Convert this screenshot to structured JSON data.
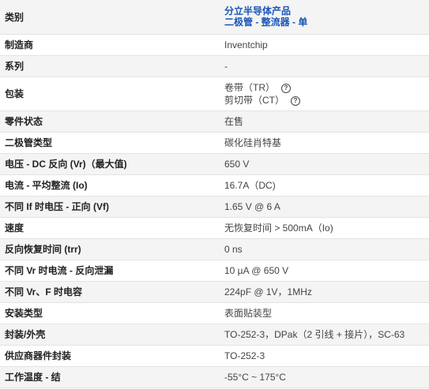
{
  "rows": [
    {
      "label": "类别",
      "links": [
        "分立半导体产品",
        "二极管 - 整流器 - 单"
      ]
    },
    {
      "label": "制造商",
      "value": "Inventchip"
    },
    {
      "label": "系列",
      "value": "-"
    },
    {
      "label": "包装",
      "options": [
        {
          "text": "卷带（TR）",
          "help": "?"
        },
        {
          "text": "剪切带（CT）",
          "help": "?"
        }
      ]
    },
    {
      "label": "零件状态",
      "value": "在售"
    },
    {
      "label": "二极管类型",
      "value": "碳化硅肖特基"
    },
    {
      "label": "电压 - DC 反向 (Vr)（最大值)",
      "value": "650 V"
    },
    {
      "label": "电流 - 平均整流 (Io)",
      "value": "16.7A（DC)"
    },
    {
      "label": "不同 If 时电压 - 正向 (Vf)",
      "value": "1.65 V @ 6 A"
    },
    {
      "label": "速度",
      "value": "无恢复时间 > 500mA（Io)"
    },
    {
      "label": "反向恢复时间 (trr)",
      "value": "0 ns"
    },
    {
      "label": "不同 Vr 时电流 - 反向泄漏",
      "value": "10 µA @ 650 V"
    },
    {
      "label": "不同 Vr、F 时电容",
      "value": "224pF @ 1V，1MHz"
    },
    {
      "label": "安装类型",
      "value": "表面贴装型"
    },
    {
      "label": "封装/外壳",
      "value": "TO-252-3，DPak（2 引线 + 接片），SC-63"
    },
    {
      "label": "供应商器件封装",
      "value": "TO-252-3"
    },
    {
      "label": "工作温度 - 结",
      "value": "-55°C ~ 175°C"
    }
  ]
}
